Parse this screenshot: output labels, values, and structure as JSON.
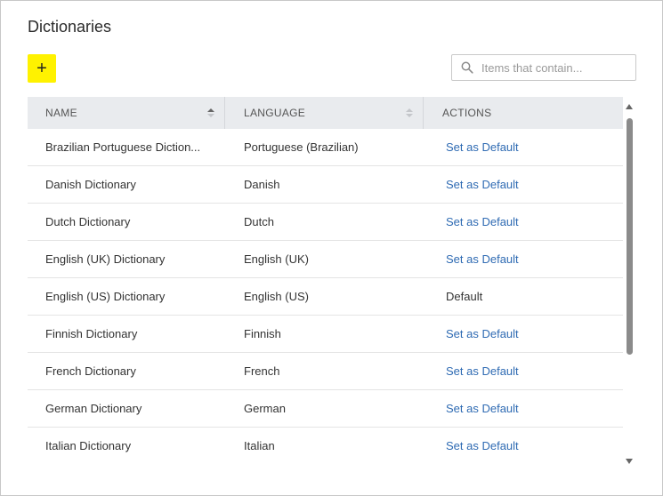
{
  "page": {
    "title": "Dictionaries"
  },
  "toolbar": {
    "add_label": "+"
  },
  "search": {
    "placeholder": "Items that contain...",
    "value": ""
  },
  "table": {
    "columns": [
      {
        "label": "NAME",
        "sort": "ascending"
      },
      {
        "label": "LANGUAGE",
        "sort": "none"
      },
      {
        "label": "ACTIONS"
      }
    ],
    "rows": [
      {
        "name": "Brazilian Portuguese Diction...",
        "language": "Portuguese (Brazilian)",
        "action": "Set as Default",
        "action_is_link": true
      },
      {
        "name": "Danish Dictionary",
        "language": "Danish",
        "action": "Set as Default",
        "action_is_link": true
      },
      {
        "name": "Dutch Dictionary",
        "language": "Dutch",
        "action": "Set as Default",
        "action_is_link": true
      },
      {
        "name": "English (UK) Dictionary",
        "language": "English (UK)",
        "action": "Set as Default",
        "action_is_link": true
      },
      {
        "name": "English (US) Dictionary",
        "language": "English (US)",
        "action": "Default",
        "action_is_link": false
      },
      {
        "name": "Finnish Dictionary",
        "language": "Finnish",
        "action": "Set as Default",
        "action_is_link": true
      },
      {
        "name": "French Dictionary",
        "language": "French",
        "action": "Set as Default",
        "action_is_link": true
      },
      {
        "name": "German Dictionary",
        "language": "German",
        "action": "Set as Default",
        "action_is_link": true
      },
      {
        "name": "Italian Dictionary",
        "language": "Italian",
        "action": "Set as Default",
        "action_is_link": true
      }
    ]
  },
  "icons": {
    "search": "search-icon",
    "sort": "sort-icon"
  },
  "colors": {
    "accent": "#fff200",
    "link": "#2f6bb3",
    "header_bg": "#e9ebee"
  }
}
